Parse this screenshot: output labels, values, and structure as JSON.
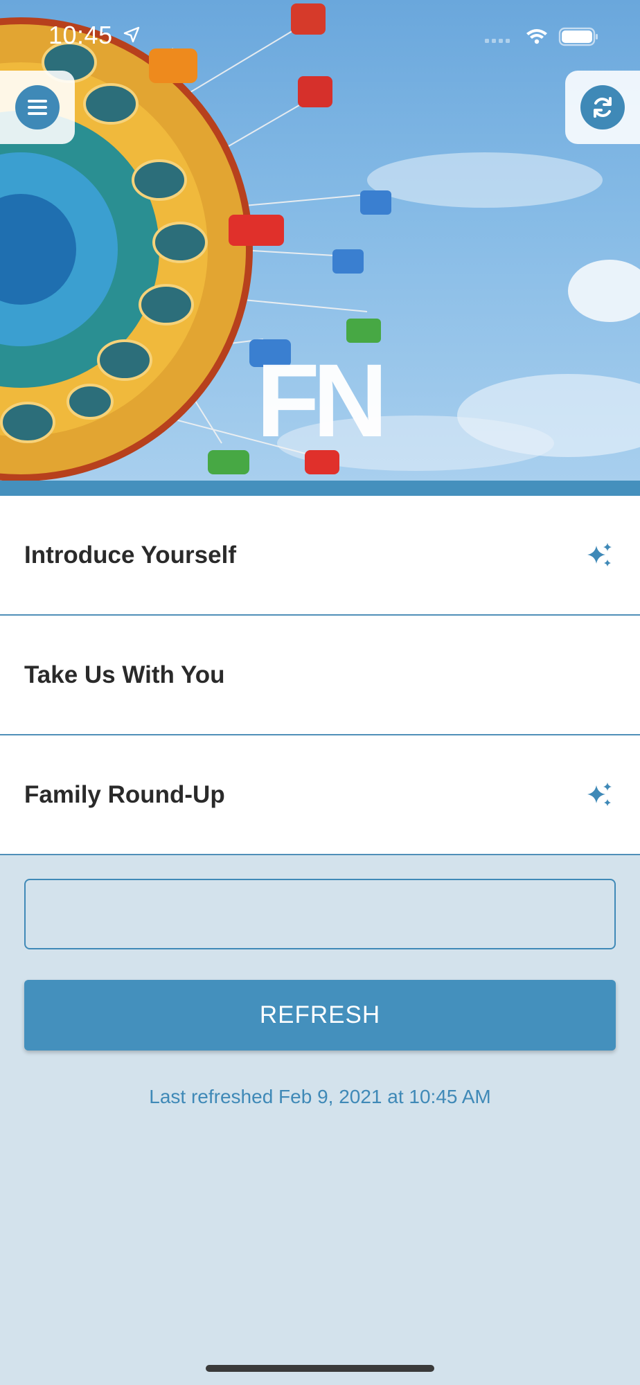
{
  "status_bar": {
    "time": "10:45"
  },
  "hero": {
    "logo_text": "FN"
  },
  "icons": {
    "menu": "menu-icon",
    "refresh": "refresh-icon",
    "sparkle": "sparkle-icon"
  },
  "list": {
    "items": [
      {
        "label": "Introduce Yourself",
        "has_sparkle": true
      },
      {
        "label": "Take Us With You",
        "has_sparkle": false
      },
      {
        "label": "Family Round-Up",
        "has_sparkle": true
      }
    ]
  },
  "form": {
    "input_value": "",
    "refresh_label": "REFRESH",
    "last_refreshed": "Last refreshed Feb 9, 2021 at 10:45 AM"
  },
  "colors": {
    "accent": "#4490bd",
    "background": "#d3e2ec",
    "divider": "#4f8fb8"
  }
}
